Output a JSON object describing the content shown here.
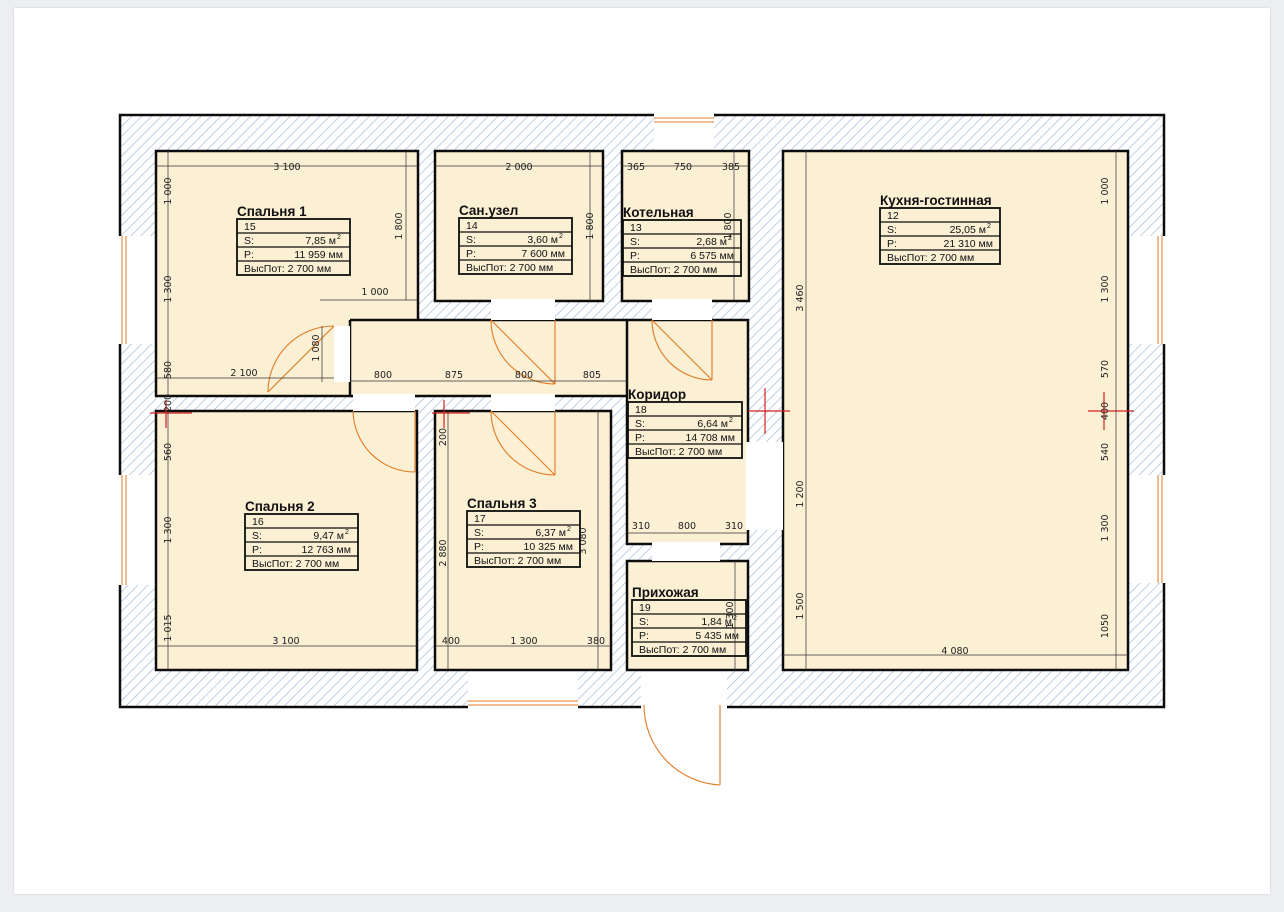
{
  "colors": {
    "floor": "#fbefd4",
    "wall": "#0d0d0d",
    "hatch": "#9fb6d6",
    "door": "#e07b24",
    "axis": "#d42020"
  },
  "rooms": [
    {
      "id": "r15",
      "name": "Спальня 1",
      "number": "15",
      "s_label": "S:",
      "s_value": "7,85 м",
      "s_sup": "2",
      "p_label": "P:",
      "p_value": "11 959 мм",
      "h_value": "ВысПот: 2 700 мм"
    },
    {
      "id": "r14",
      "name": "Сан.узел",
      "number": "14",
      "s_label": "S:",
      "s_value": "3,60 м",
      "s_sup": "2",
      "p_label": "P:",
      "p_value": "7 600 мм",
      "h_value": "ВысПот: 2 700 мм"
    },
    {
      "id": "r13",
      "name": "Котельная",
      "number": "13",
      "s_label": "S:",
      "s_value": "2,68 м",
      "s_sup": "2",
      "p_label": "P:",
      "p_value": "6 575 мм",
      "h_value": "ВысПот: 2 700 мм"
    },
    {
      "id": "r12",
      "name": "Кухня-гостинная",
      "number": "12",
      "s_label": "S:",
      "s_value": "25,05 м",
      "s_sup": "2",
      "p_label": "P:",
      "p_value": "21 310 мм",
      "h_value": "ВысПот:  2 700 мм"
    },
    {
      "id": "r18",
      "name": "Коридор",
      "number": "18",
      "s_label": "S:",
      "s_value": "6,64 м",
      "s_sup": "2",
      "p_label": "P:",
      "p_value": "14 708 мм",
      "h_value": "ВысПот: 2 700 мм"
    },
    {
      "id": "r16",
      "name": "Спальня 2",
      "number": "16",
      "s_label": "S:",
      "s_value": "9,47 м",
      "s_sup": "2",
      "p_label": "P:",
      "p_value": "12 763 мм",
      "h_value": "ВысПот: 2 700 мм"
    },
    {
      "id": "r17",
      "name": "Спальня 3",
      "number": "17",
      "s_label": "S:",
      "s_value": "6,37 м",
      "s_sup": "2",
      "p_label": "P:",
      "p_value": "10 325 мм",
      "h_value": "ВысПот: 2 700 мм"
    },
    {
      "id": "r19",
      "name": "Прихожая",
      "number": "19",
      "s_label": "S:",
      "s_value": "1,84 м",
      "s_sup": "2",
      "p_label": "P:",
      "p_value": "5 435 мм",
      "h_value": "ВысПот: 2 700 мм"
    }
  ],
  "dimensions": [
    "3 100",
    "1 000",
    "1 300",
    "580",
    "1 800",
    "1 000",
    "2 100",
    "1 080",
    "2 000",
    "1 800",
    "365",
    "750",
    "385",
    "1 800",
    "800",
    "875",
    "800",
    "805",
    "200",
    "560",
    "1 300",
    "1 015",
    "3 100",
    "200",
    "2 880",
    "3 080",
    "400",
    "1 300",
    "380",
    "310",
    "800",
    "310",
    "1 300",
    "3 460",
    "1 200",
    "1 500",
    "1 000",
    "1 300",
    "570",
    "400",
    "540",
    "1 300",
    "1050",
    "4 080"
  ]
}
